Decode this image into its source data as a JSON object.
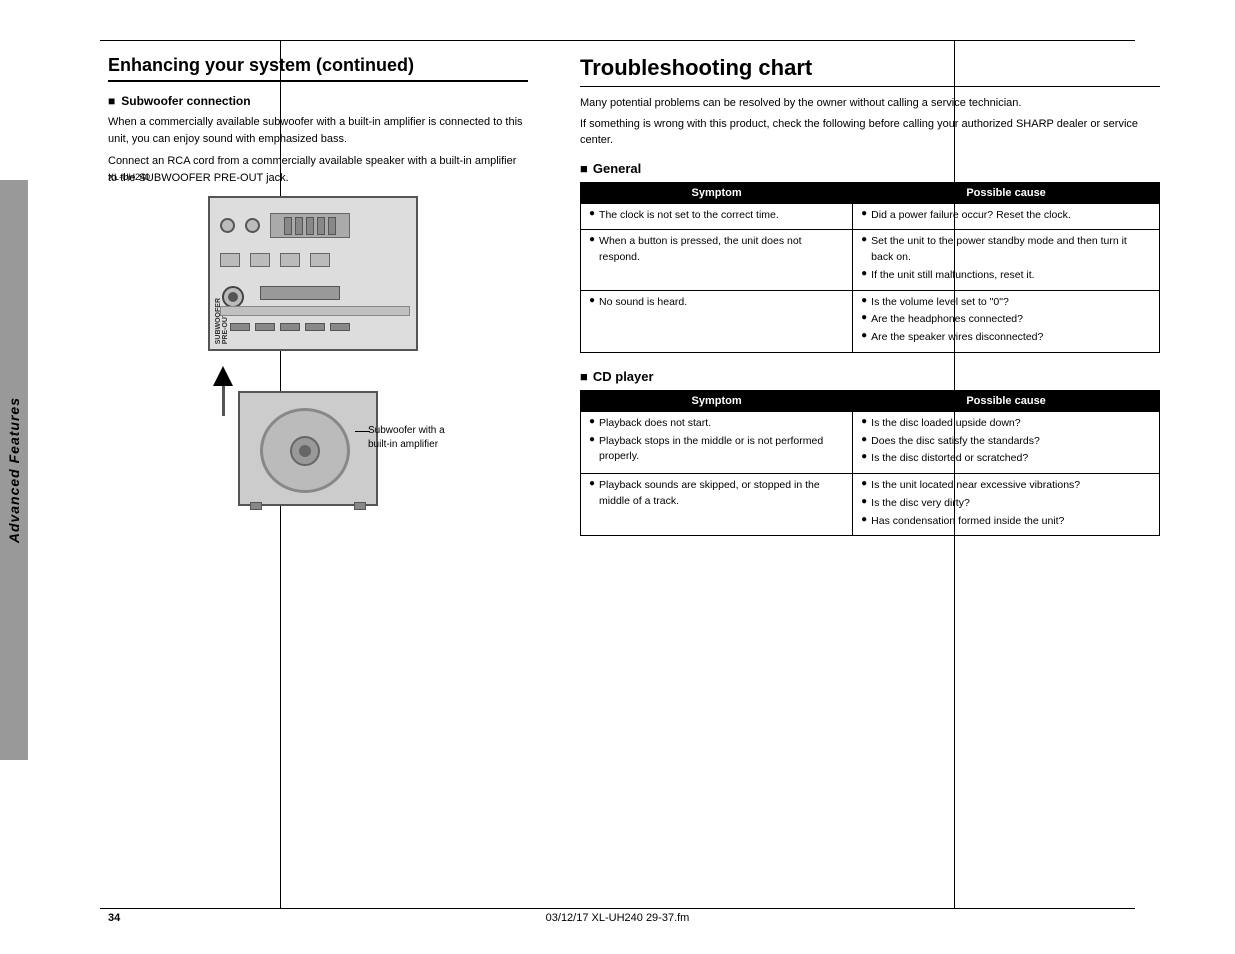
{
  "meta": {
    "model": "XL-UH240",
    "page_number": "34",
    "footer_text": "03/12/17    XL-UH240 29-37.fm"
  },
  "left_section": {
    "title": "Enhancing your system (continued)",
    "subsection_title": "Subwoofer connection",
    "body_text_1": "When a commercially available subwoofer with a built-in amplifier is connected to this unit, you can enjoy sound with emphasized bass.",
    "body_text_2": "Connect an RCA cord from a commercially available speaker with a built-in amplifier to the SUBWOOFER PRE-OUT jack.",
    "image_label": "Subwoofer with a built-in amplifier",
    "preout_label": "SUBWOOFER PRE-OUT"
  },
  "right_section": {
    "title": "Troubleshooting chart",
    "intro_text_1": "Many potential problems can be resolved by the owner without calling a service technician.",
    "intro_text_2": "If something is wrong with this product, check the following before calling your authorized SHARP dealer or service center.",
    "general_section": {
      "title": "General",
      "symptom_header": "Symptom",
      "cause_header": "Possible cause",
      "rows": [
        {
          "symptom": "The clock is not set to the correct time.",
          "causes": [
            "Did a power failure occur? Reset the clock."
          ]
        },
        {
          "symptom": "When a button is pressed, the unit does not respond.",
          "causes": [
            "Set the unit to the power standby mode and then turn it back on.",
            "If the unit still malfunctions, reset it."
          ]
        },
        {
          "symptom": "No sound is heard.",
          "causes": [
            "Is the volume level set to \"0\"?",
            "Are the headphones connected?",
            "Are the speaker wires disconnected?"
          ]
        }
      ]
    },
    "cd_section": {
      "title": "CD player",
      "symptom_header": "Symptom",
      "cause_header": "Possible cause",
      "rows": [
        {
          "symptom_items": [
            "Playback does not start.",
            "Playback stops in the middle or is not performed properly."
          ],
          "causes": [
            "Is the disc loaded upside down?",
            "Does the disc satisfy the standards?",
            "Is the disc distorted or scratched?"
          ]
        },
        {
          "symptom_items": [
            "Playback sounds are skipped, or stopped in the middle of a track."
          ],
          "causes": [
            "Is the unit located near excessive vibrations?",
            "Is the disc very dirty?",
            "Has condensation formed inside the unit?"
          ]
        }
      ]
    }
  },
  "sidebar": {
    "label": "Advanced Features"
  }
}
